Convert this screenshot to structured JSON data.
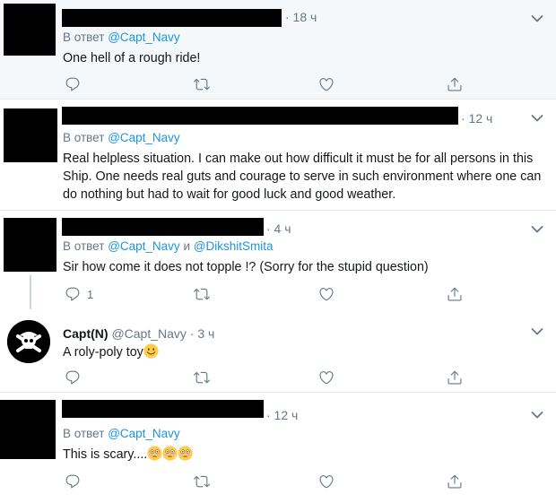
{
  "tweets": [
    {
      "time": "· 18 ч",
      "reply_prefix": "В ответ",
      "reply_to": "@Capt_Navy",
      "text": "One hell of a rough ride!",
      "reply_count": ""
    },
    {
      "time": "· 12 ч",
      "reply_prefix": "В ответ",
      "reply_to": "@Capt_Navy",
      "text": "Real helpless situation. I can make out how difficult it must be for all persons in this Ship. One needs real guts and courage to serve in such environment where one can do nothing but had to wait for good luck and good weather.",
      "reply_count": ""
    },
    {
      "time": "· 4 ч",
      "reply_prefix": "В ответ",
      "reply_to": "@Capt_Navy",
      "reply_conj": "и",
      "reply_to2": "@DikshitSmita",
      "text": "Sir how come it does not topple !? (Sorry for the stupid question)",
      "reply_count": "1"
    },
    {
      "name": "Capt(N)",
      "handle": "@Capt_Navy",
      "time": "· 3 ч",
      "text": "A roly-poly toy",
      "emoji": "slightly-smiling-face",
      "reply_count": ""
    },
    {
      "time": "· 12 ч",
      "reply_prefix": "В ответ",
      "reply_to": "@Capt_Navy",
      "text": "This is scary....",
      "emoji": "flushed-face x3",
      "reply_count": ""
    }
  ],
  "icons": {
    "reply": "reply-icon",
    "retweet": "retweet-icon",
    "like": "heart-icon",
    "share": "share-icon",
    "more": "chevron-down-icon"
  },
  "colors": {
    "link": "#1b95e0",
    "secondary_text": "#657786",
    "highlight_bg": "#f5f8fa",
    "divider": "#e6ecf0"
  }
}
